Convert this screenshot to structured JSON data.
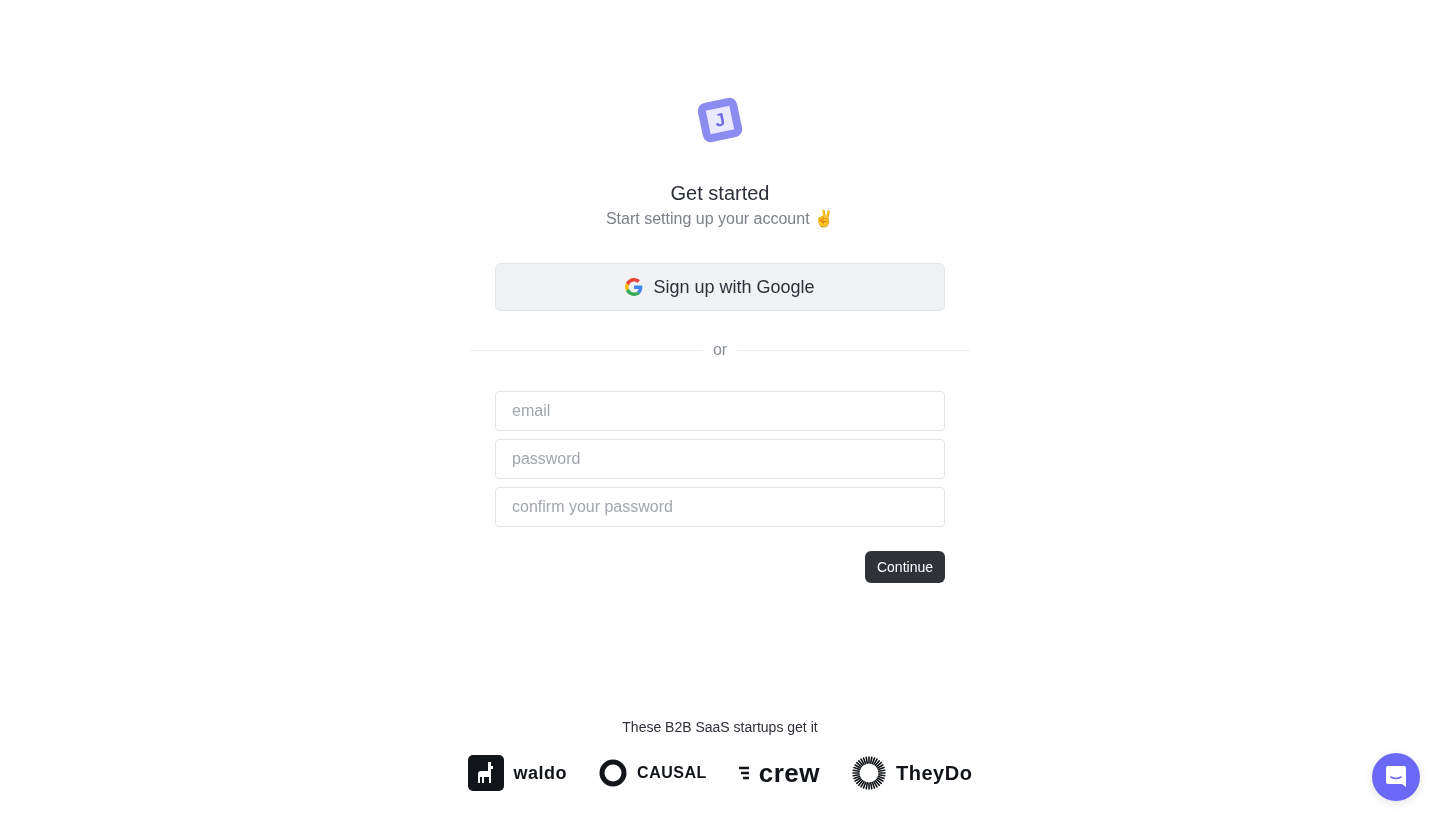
{
  "logo": {
    "letter": "J"
  },
  "heading": "Get started",
  "subheading": "Start setting up your account ✌️",
  "google_button": {
    "label": "Sign up with Google"
  },
  "divider": "or",
  "fields": [
    {
      "placeholder": "email"
    },
    {
      "placeholder": "password"
    },
    {
      "placeholder": "confirm your password"
    }
  ],
  "continue_button": "Continue",
  "footer": {
    "caption": "These B2B SaaS startups get it",
    "logos": [
      {
        "kind": "waldo",
        "name": "waldo"
      },
      {
        "kind": "causal",
        "name": "CAUSAL"
      },
      {
        "kind": "crew",
        "name": "crew"
      },
      {
        "kind": "theydo",
        "name": "TheyDo"
      }
    ]
  }
}
